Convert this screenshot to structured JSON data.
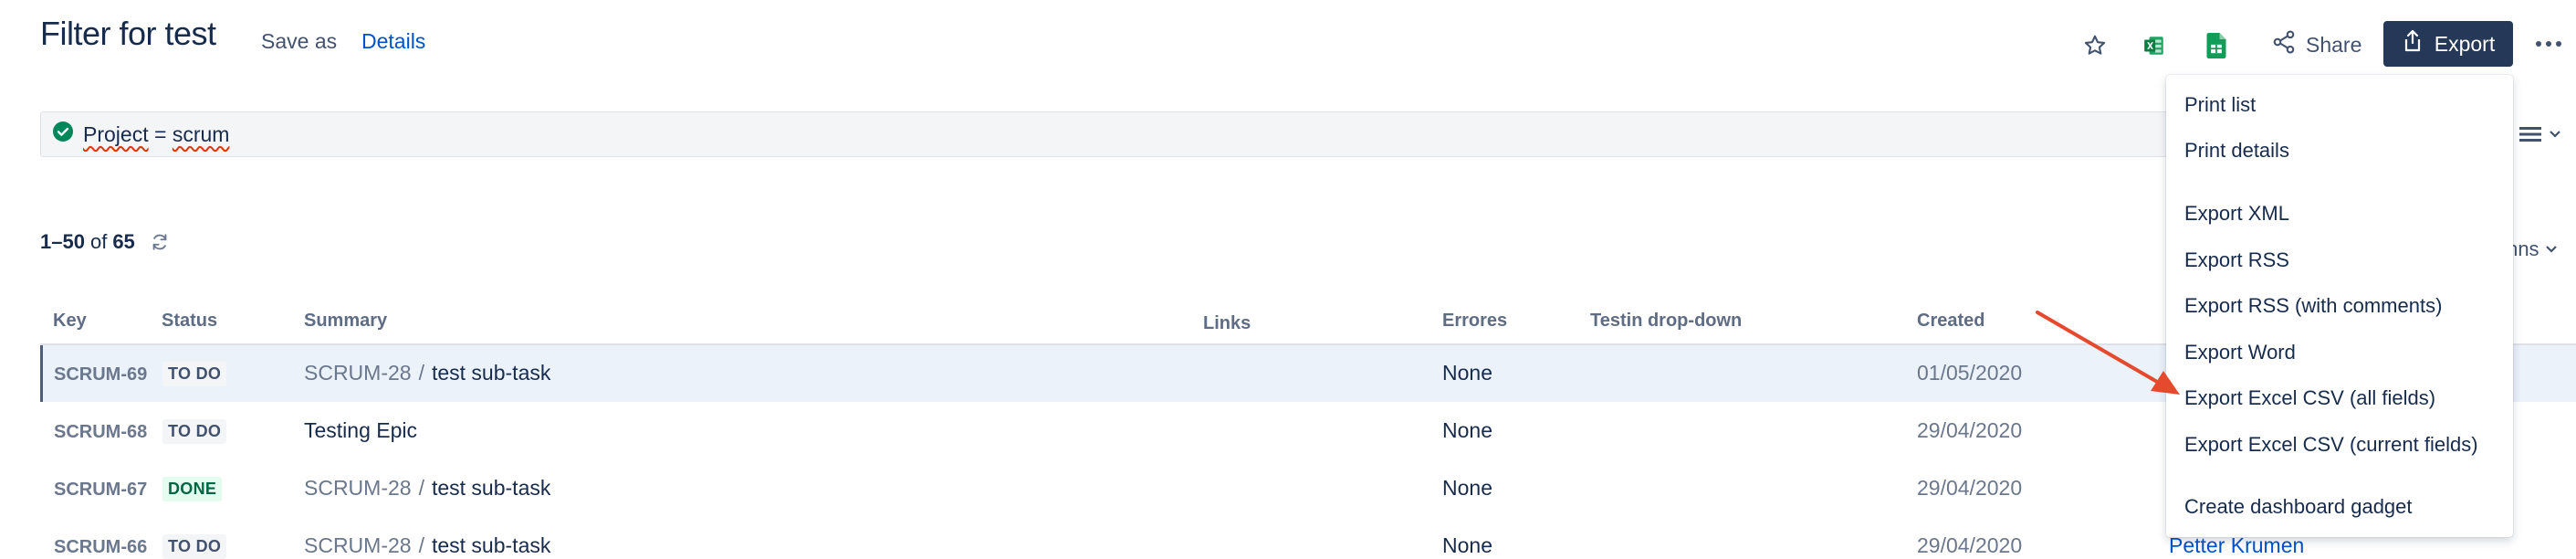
{
  "header": {
    "title": "Filter for test",
    "save_as": "Save as",
    "details": "Details",
    "share": "Share",
    "export": "Export"
  },
  "icons": {
    "star": "star-icon",
    "excel": "excel-icon",
    "sheets": "google-sheets-icon",
    "share": "share-icon",
    "export": "export-icon",
    "more": "more-icon",
    "valid": "check-circle-icon",
    "refresh": "refresh-icon",
    "list_view": "list-view-icon"
  },
  "jql": {
    "field": "Project",
    "operator": "=",
    "value": "scrum"
  },
  "results": {
    "range": "1–50",
    "of": "of",
    "total": "65",
    "columns_partial": "mns"
  },
  "table": {
    "headers": {
      "key": "Key",
      "status": "Status",
      "summary": "Summary",
      "links": "Links",
      "errores": "Errores",
      "testin": "Testin drop-down",
      "created": "Created"
    },
    "rows": [
      {
        "key": "SCRUM-69",
        "status": "TO DO",
        "parent": "SCRUM-28",
        "summary": "test sub-task",
        "errores": "None",
        "created": "01/05/2020",
        "assignee": ""
      },
      {
        "key": "SCRUM-68",
        "status": "TO DO",
        "parent": "",
        "summary": "Testing Epic",
        "errores": "None",
        "created": "29/04/2020",
        "assignee": ""
      },
      {
        "key": "SCRUM-67",
        "status": "DONE",
        "parent": "SCRUM-28",
        "summary": "test sub-task",
        "errores": "None",
        "created": "29/04/2020",
        "assignee": ""
      },
      {
        "key": "SCRUM-66",
        "status": "TO DO",
        "parent": "SCRUM-28",
        "summary": "test sub-task",
        "errores": "None",
        "created": "29/04/2020",
        "assignee": "Petter Krumen"
      }
    ]
  },
  "export_menu": {
    "items": [
      "Print list",
      "Print details",
      "Export XML",
      "Export RSS",
      "Export RSS (with comments)",
      "Export Word",
      "Export Excel CSV (all fields)",
      "Export Excel CSV (current fields)",
      "Create dashboard gadget"
    ]
  },
  "colors": {
    "export_button": "#253858",
    "link": "#0052CC",
    "done_lozenge_bg": "#E3FCEF",
    "done_lozenge_text": "#006644",
    "annotation_arrow": "#E5492E"
  }
}
